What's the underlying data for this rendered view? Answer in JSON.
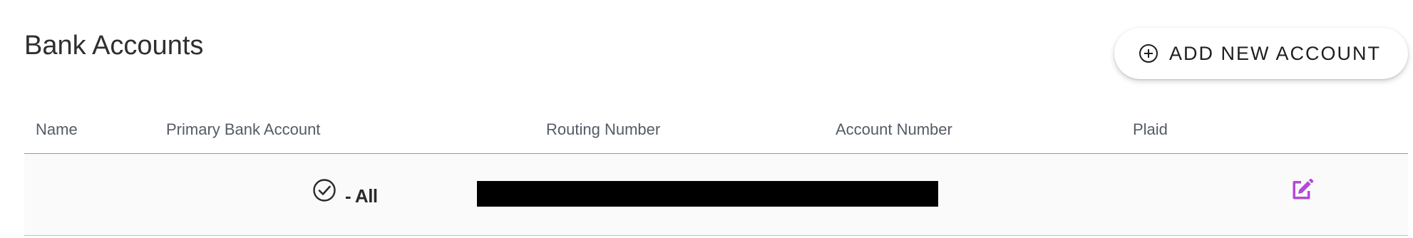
{
  "page": {
    "title": "Bank Accounts"
  },
  "toolbar": {
    "add_button_label": "ADD NEW ACCOUNT",
    "add_button_icon": "plus-circle-icon"
  },
  "table": {
    "columns": [
      "Name",
      "Primary Bank Account",
      "Routing Number",
      "Account Number",
      "Plaid"
    ],
    "rows": [
      {
        "name": "",
        "primary_icon": "check-circle-icon",
        "primary_text": "- All",
        "routing_number": "",
        "account_number": "",
        "plaid": "",
        "action_icon": "edit-icon"
      }
    ]
  },
  "colors": {
    "accent": "#b349d8",
    "header_text": "#545b66",
    "redaction": "#000000"
  }
}
